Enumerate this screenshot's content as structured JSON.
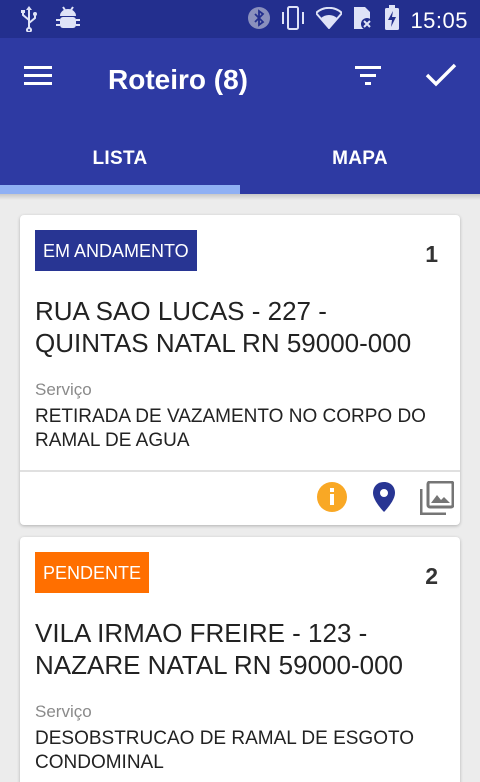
{
  "status_bar": {
    "time": "15:05",
    "icons": [
      "usb-icon",
      "android-debug-icon",
      "bluetooth-icon",
      "vibrate-icon",
      "wifi-icon",
      "no-sim-icon",
      "battery-charging-icon"
    ]
  },
  "app_bar": {
    "title": "Roteiro (8)",
    "icons": [
      "menu-icon",
      "filter-icon",
      "check-icon"
    ]
  },
  "tabs": [
    {
      "label": "LISTA",
      "selected": true
    },
    {
      "label": "MAPA",
      "selected": false
    }
  ],
  "cards": [
    {
      "number": "1",
      "status": "EM ANDAMENTO",
      "status_color": "#283593",
      "address": "RUA SAO LUCAS - 227 - QUINTAS NATAL RN 59000-000",
      "service_label": "Serviço",
      "service": "RETIRADA DE VAZAMENTO NO CORPO DO RAMAL DE AGUA",
      "actions": [
        "info-icon",
        "location-pin-icon",
        "photos-icon"
      ]
    },
    {
      "number": "2",
      "status": "PENDENTE",
      "status_color": "#ff6f00",
      "address": "VILA IRMAO FREIRE - 123 - NAZARE NATAL RN 59000-000",
      "service_label": "Serviço",
      "service": "DESOBSTRUCAO DE RAMAL DE ESGOTO CONDOMINAL"
    }
  ],
  "colors": {
    "primary": "#2e3aa3",
    "status_bar": "#232f8e",
    "tab_indicator": "#8fb0f4",
    "info": "#f9a825",
    "pin": "#283593"
  }
}
